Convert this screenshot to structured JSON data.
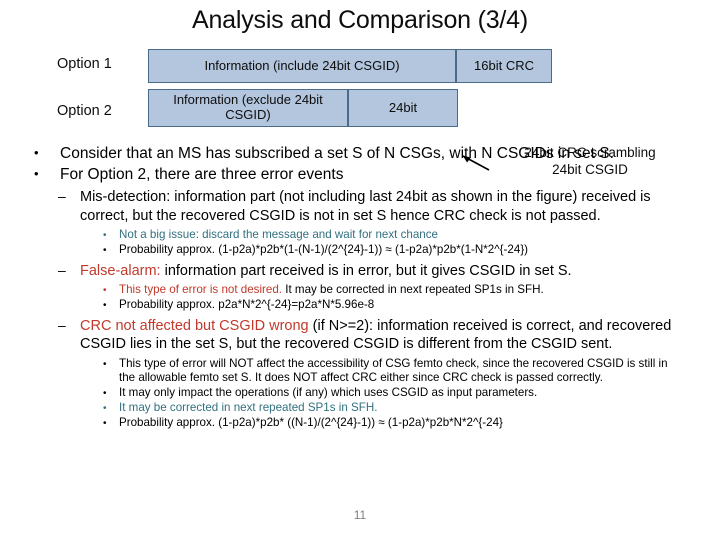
{
  "slide": {
    "title": "Analysis and Comparison (3/4)",
    "page_number": "11"
  },
  "colors": {
    "box_fill": "#b3c6de",
    "box_border": "#4a6b8a",
    "accent_red": "#c0392b",
    "accent_teal": "#31707f",
    "page_number": "#808080"
  },
  "diagram": {
    "option1": {
      "label": "Option 1",
      "boxes": [
        {
          "text": "Information (include 24bit CSGID)"
        },
        {
          "text": "16bit CRC"
        }
      ]
    },
    "option2": {
      "label": "Option 2",
      "boxes": [
        {
          "text": "Information (exclude 24bit CSGID)"
        },
        {
          "text": "24bit"
        }
      ]
    },
    "annotation_line1": "24bit CRC scrambling",
    "annotation_line2": "24bit CSGID"
  },
  "bullets": {
    "b1": "Consider that an MS has subscribed a set S of N CSGs, with N CSGIDs in set S.",
    "b2": "For Option 2, there are three error events",
    "mis_detection": {
      "heading": "Mis-detection:",
      "body": " information part (not including last 24bit as shown in the figure) received is correct, but the recovered CSGID is not in set S hence CRC check is not passed.",
      "sub1_colored": "Not a big issue: discard the message and wait for next chance",
      "sub2": "Probability approx. (1-p2a)*p2b*(1-(N-1)/(2^{24}-1)) ≈ (1-p2a)*p2b*(1-N*2^{-24})"
    },
    "false_alarm": {
      "heading": "False-alarm:",
      "body": " information part received is in error, but it gives CSGID in set S.",
      "sub1_colored": "This type of error is not desired.",
      "sub1_rest": "  It may be corrected in next repeated SP1s in SFH.",
      "sub2": "Probability approx.  p2a*N*2^{-24}=p2a*N*5.96e-8"
    },
    "crc_wrong": {
      "heading": "CRC not affected but CSGID wrong",
      "body": " (if N>=2): information received is correct, and recovered CSGID lies in the set S, but the recovered CSGID is different from the CSGID sent.",
      "sub1": "This type of error will NOT affect the accessibility of CSG femto check, since the recovered CSGID is still in the allowable femto set S. It does NOT affect CRC either since CRC check is passed correctly.",
      "sub2": "It may only impact the operations (if any) which uses CSGID as input parameters.",
      "sub3_colored": "It may be corrected",
      "sub3_rest": " in next repeated SP1s in SFH.",
      "sub4": "Probability approx. (1-p2a)*p2b* ((N-1)/(2^{24}-1)) ≈ (1-p2a)*p2b*N*2^{-24}"
    }
  },
  "symbols": {
    "bullet_dot": "•",
    "bullet_dash": "–"
  }
}
